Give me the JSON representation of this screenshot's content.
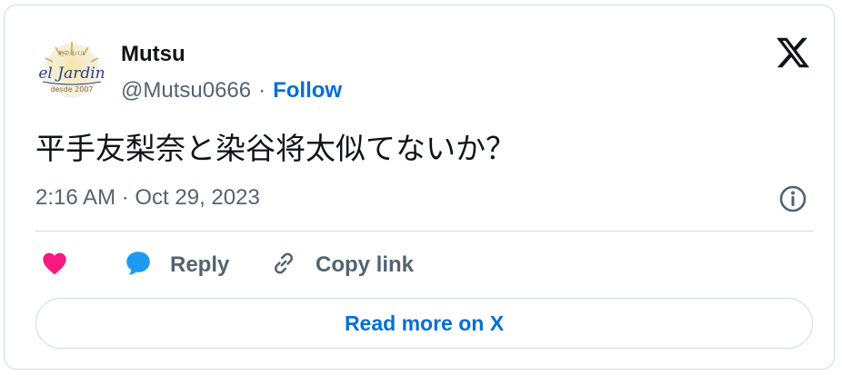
{
  "author": {
    "name": "Mutsu",
    "handle": "@Mutsu0666",
    "separator": "·",
    "follow_label": "Follow",
    "avatar_text": "el Jardin",
    "avatar_subtext": "desde 2007"
  },
  "tweet": {
    "text": "平手友梨奈と染谷将太似てないか？",
    "timestamp": "2:16 AM · Oct 29, 2023"
  },
  "actions": {
    "reply_label": "Reply",
    "copy_label": "Copy link"
  },
  "footer": {
    "read_more_label": "Read more on X"
  },
  "colors": {
    "link_blue": "#006fd6",
    "like_pink": "#f91880",
    "reply_blue": "#1d9bf0",
    "secondary_text": "#536471",
    "border": "#cfd9de"
  },
  "icons": [
    "x-logo-icon",
    "info-icon",
    "heart-icon",
    "reply-bubble-icon",
    "link-icon"
  ]
}
